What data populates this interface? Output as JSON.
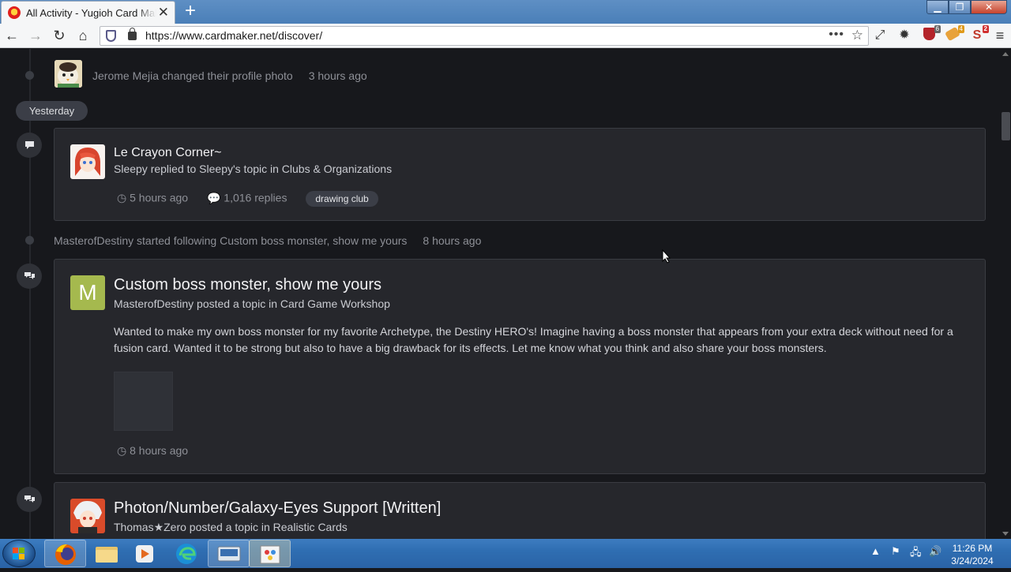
{
  "browser": {
    "tab_title": "All Activity - Yugioh Card Maker Forum",
    "url": "https://www.cardmaker.net/discover/",
    "new_tab": "+",
    "extensions": [
      {
        "name": "ublock-origin-icon",
        "badge": "6",
        "badge_color": "#666666"
      },
      {
        "name": "extension-orange-icon",
        "badge": "4",
        "badge_color": "#e09a1a"
      },
      {
        "name": "extension-red-s-icon",
        "badge": "2",
        "badge_color": "#d12f2f"
      }
    ]
  },
  "activity": {
    "item1": {
      "text": "Jerome Mejia changed their profile photo",
      "time": "3 hours ago"
    },
    "divider": "Yesterday",
    "card1": {
      "title": "Le Crayon Corner~",
      "subtitle": "Sleepy replied to Sleepy's topic in Clubs & Organizations",
      "time": "5 hours ago",
      "replies": "1,016 replies",
      "tag": "drawing club"
    },
    "item2": {
      "text": "MasterofDestiny started following Custom boss monster, show me yours",
      "time": "8 hours ago"
    },
    "card2": {
      "avatar_letter": "M",
      "avatar_color": "#a5b94e",
      "title": "Custom boss monster, show me yours",
      "subtitle": "MasterofDestiny posted a topic in Card Game Workshop",
      "body": "Wanted to make my own boss monster for my favorite Archetype, the Destiny HERO's! Imagine having a boss monster that appears from your extra deck without need for a fusion card. Wanted it to be strong but also to have a big drawback for its effects. Let me know what you think and also share your boss monsters.",
      "time": "8 hours ago"
    },
    "card3": {
      "title": "Photon/Number/Galaxy-Eyes Support [Written]",
      "subtitle": "Thomas★Zero posted a topic in Realistic Cards"
    }
  },
  "taskbar": {
    "time": "11:26 PM",
    "date": "3/24/2024"
  },
  "colors": {
    "page_bg": "#17181c",
    "card_bg": "#26272c",
    "accent_green": "#a5b94e"
  }
}
